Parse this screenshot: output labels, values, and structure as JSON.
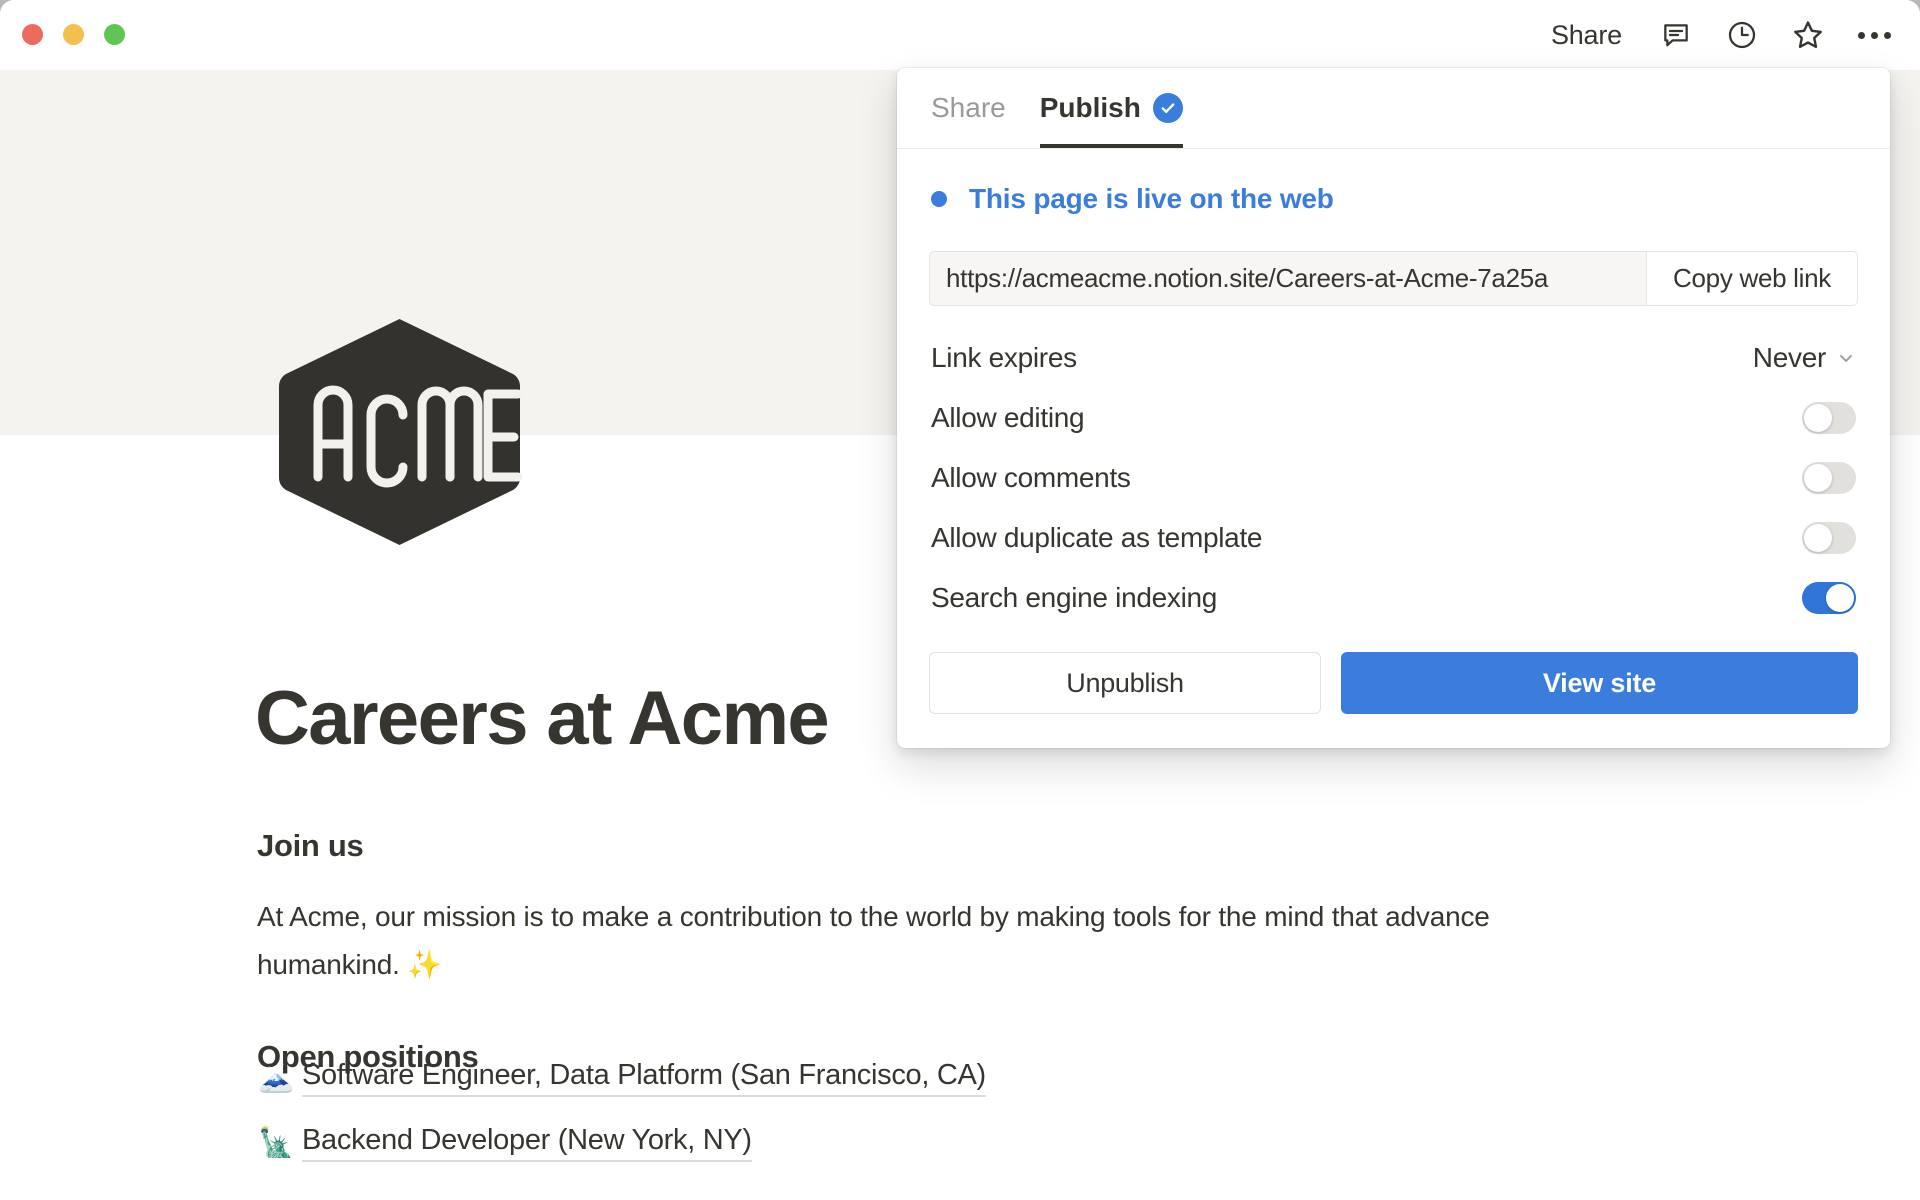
{
  "window": {
    "traffic_lights": [
      "close",
      "minimize",
      "zoom"
    ]
  },
  "titlebar": {
    "share_label": "Share",
    "icons": [
      "comment-icon",
      "history-clock-icon",
      "star-icon",
      "more-options-icon"
    ]
  },
  "page": {
    "icon_text": "ACME",
    "title": "Careers at Acme",
    "sections": [
      {
        "heading": "Join us"
      },
      {
        "heading": "Open positions"
      }
    ],
    "mission_paragraph": "At Acme, our mission is to make a contribution to the world by making tools for the mind that advance humankind. ✨",
    "jobs": [
      {
        "emoji": "🗻",
        "emoji_name": "mount-fuji-emoji",
        "label": "Software Engineer, Data Platform (San Francisco, CA)"
      },
      {
        "emoji": "🗽",
        "emoji_name": "statue-of-liberty-emoji",
        "label": "Backend Developer (New York, NY)"
      }
    ]
  },
  "dialog": {
    "tabs": [
      {
        "label": "Share",
        "active": false
      },
      {
        "label": "Publish",
        "active": true
      }
    ],
    "status_text": "This page is live on the web",
    "url_value": "https://acmeacme.notion.site/Careers-at-Acme-7a25a",
    "copy_button_label": "Copy web link",
    "settings": [
      {
        "label": "Link expires",
        "type": "select",
        "value": "Never"
      },
      {
        "label": "Allow editing",
        "type": "toggle",
        "on": false
      },
      {
        "label": "Allow comments",
        "type": "toggle",
        "on": false
      },
      {
        "label": "Allow duplicate as template",
        "type": "toggle",
        "on": false
      },
      {
        "label": "Search engine indexing",
        "type": "toggle",
        "on": true
      }
    ],
    "unpublish_label": "Unpublish",
    "view_site_label": "View site"
  },
  "colors": {
    "accent_blue": "#3b7ddd",
    "toggle_on": "#2f76d8",
    "text": "#37352f",
    "muted_text": "#9b9a97",
    "cover": "#f5f3ef",
    "logo_dark": "#33322f"
  }
}
